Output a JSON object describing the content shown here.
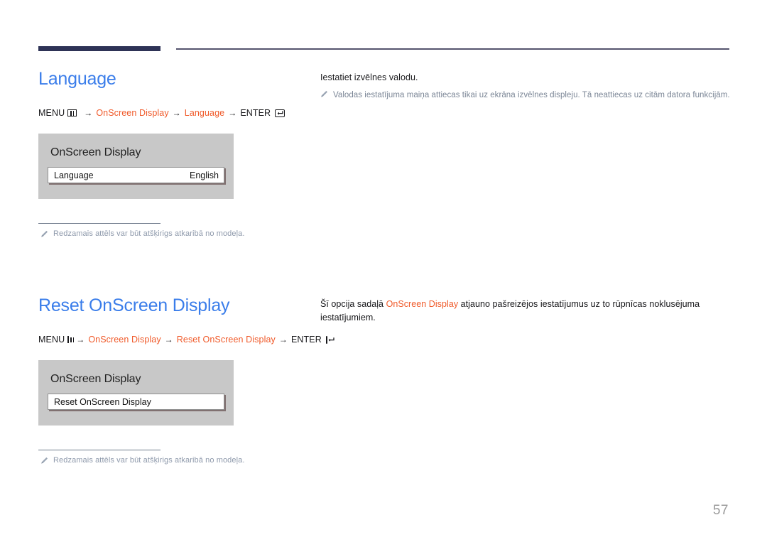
{
  "page": {
    "number": "57"
  },
  "sections": [
    {
      "heading": "Language",
      "breadcrumb": {
        "menu_label": "MENU",
        "menu_icon": "menu-grid-icon",
        "arrow": "→",
        "path1": "OnScreen Display",
        "path2": "Language",
        "enter_label": "ENTER",
        "enter_icon": "enter-return-icon"
      },
      "osd": {
        "title": "OnScreen Display",
        "row_label": "Language",
        "row_value": "English"
      },
      "note": {
        "icon": "pencil-icon",
        "text": "Redzamais attēls var būt atšķirigs atkaribā no modeļa."
      },
      "body": {
        "lead": "Iestatiet izvēlnes valodu.",
        "note_icon": "pencil-icon",
        "note": "Valodas iestatījuma maiņa attiecas tikai uz ekrāna izvēlnes displeju. Tā neattiecas uz citām datora funkcijām."
      }
    },
    {
      "heading": "Reset OnScreen Display",
      "breadcrumb": {
        "menu_label": "MENU",
        "menu_icon": "menu-grid-icon",
        "arrow": "→",
        "path1": "OnScreen Display",
        "path2": "Reset OnScreen Display",
        "enter_label": "ENTER",
        "enter_icon": "enter-return-icon"
      },
      "osd": {
        "title": "OnScreen Display",
        "row_label": "Reset OnScreen Display",
        "row_value": ""
      },
      "note": {
        "icon": "pencil-icon",
        "text": "Redzamais attēls var būt atšķirigs atkaribā no modeļa."
      },
      "body": {
        "lead_part1": "Šī opcija sadaļā ",
        "lead_highlight": "OnScreen Display",
        "lead_part2": " atjauno pašreizējos iestatījumus uz to rūpnīcas noklusējuma iestatījumiem."
      }
    }
  ],
  "colors": {
    "heading": "#3a7dea",
    "accent_orange": "#f05a2a",
    "rule_navy": "#2e3356",
    "note_gray": "#8e99ab",
    "osd_panel": "#c8c8c8"
  }
}
